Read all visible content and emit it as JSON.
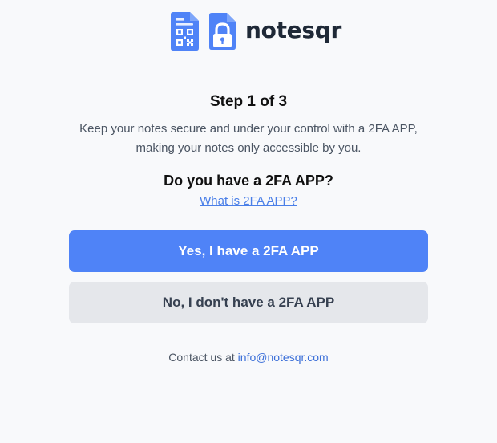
{
  "brand": {
    "name": "notesqr",
    "icons": [
      "qr-document-icon",
      "lock-document-icon"
    ],
    "accent_color": "#4f83f7"
  },
  "step": {
    "title": "Step 1 of 3"
  },
  "description": {
    "line1": "Keep your notes secure and under your control with a 2FA APP,",
    "line2": "making your notes only accessible by you."
  },
  "question": {
    "text": "Do you have a 2FA APP?",
    "help_link": "What is 2FA APP?"
  },
  "buttons": {
    "yes_label": "Yes, I have a 2FA APP",
    "no_label": "No, I don't have a 2FA APP"
  },
  "contact": {
    "prefix": "Contact us at",
    "email": "info@notesqr.com"
  }
}
